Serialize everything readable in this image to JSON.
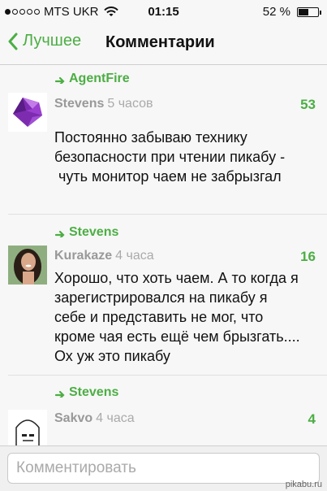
{
  "status_bar": {
    "carrier": "MTS UKR",
    "time": "01:15",
    "battery": "52 %",
    "battery_level": 0.52
  },
  "nav": {
    "back_label": "Лучшее",
    "title": "Комментарии"
  },
  "comments": [
    {
      "reply_to": "AgentFire",
      "author": "Stevens",
      "age": "5 часов",
      "score": "53",
      "lines": [
        "Постоянно забываю технику",
        "безопасности при чтении пикабу -",
        " чуть монитор чаем не забрызгал"
      ]
    },
    {
      "reply_to": "Stevens",
      "author": "Kurakaze",
      "age": "4 часа",
      "score": "16",
      "lines": [
        "Хорошо, что хоть чаем. А то когда я",
        "зарегистрировался на пикабу я",
        "себе и представить не мог, что",
        "кроме чая есть ещё чем брызгать....",
        "Ох уж это пикабу"
      ]
    },
    {
      "reply_to": "Stevens",
      "author": "Sakvo",
      "age": "4 часа",
      "score": "4",
      "lines": []
    }
  ],
  "input": {
    "placeholder": "Комментировать"
  },
  "watermark": "pikabu.ru",
  "colors": {
    "accent": "#4cae44",
    "muted": "#999999"
  }
}
